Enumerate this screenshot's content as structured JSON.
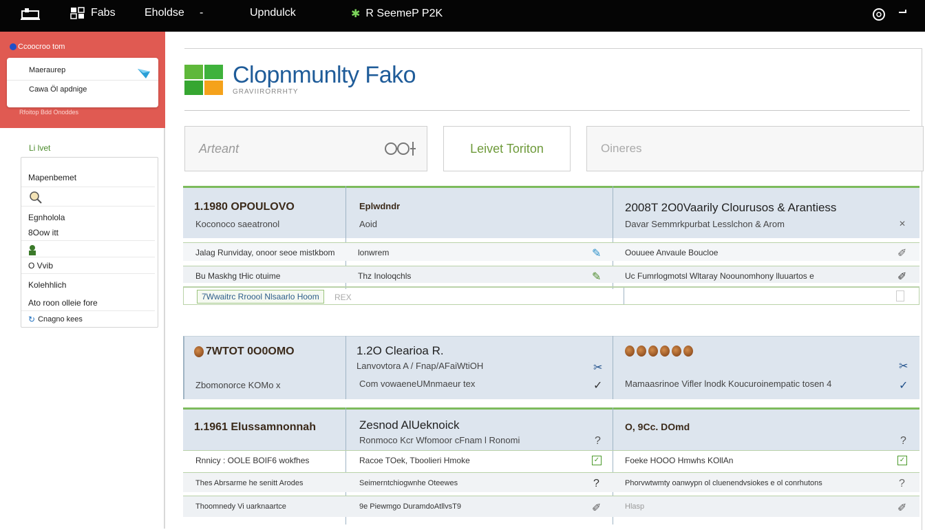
{
  "topbar": {
    "items": [
      "Fabs",
      "Eholdse",
      "-",
      "Upndulck",
      "R SeemeP P2K"
    ]
  },
  "sidebar": {
    "crumb": "Ccoocroo tom",
    "card": {
      "row1": "Maeraurep",
      "row2": "Cawa Öl apdnige"
    },
    "foot": "Rfoitop Bdd   Onoddes",
    "section_label": "Li lvet",
    "items": [
      "Mapenbemet",
      "",
      "Egnholola",
      "8Oow itt",
      "",
      "O Vvib",
      "Kolehhlich",
      "Ato roon olleie fore",
      "Cnagno kees"
    ]
  },
  "main": {
    "title": "Clopnmunlty Fako",
    "subtitle": "GRAVIIRORRHTY",
    "filters": {
      "search_placeholder": "Arteant",
      "level_button": "Leivet Toriton",
      "other_placeholder": "Oineres"
    },
    "table1": {
      "header": [
        {
          "title": "1.1980 OPOULOVO",
          "sub": "Koconoco saeatronol"
        },
        {
          "title": "Eplwdndr",
          "sub": "Aoid"
        },
        {
          "title": "2008T 2O0Vaarily  Clourusos & Arantiess",
          "sub": "Davar Semmrkpurbat Lesslchon & Arom"
        }
      ],
      "rows": [
        [
          "Jalag Runviday, onoor seoe mistkbom",
          "lonwrem",
          "Oouuee Anvaule Boucloe"
        ],
        [
          "Bu Maskhg tHic otuime",
          "Thz Inoloqchls",
          "Uc Fumrlogmotsl Wltaray Noounomhony lluuartos e"
        ]
      ],
      "input_value": "7Wwaitrc Rroool Nlsaarlo Hoom",
      "input_tag": "REX"
    },
    "table2": {
      "cols": [
        {
          "title": "7WTOT 0O0OMO",
          "sub": "Zbomonorce KOMo x"
        },
        {
          "title": "1.2O Clearioa R.",
          "line2": "Lanvovtora A / Fnap/AFaiWtiOH",
          "sub": "Com vowaeneUMnmaeur tex"
        },
        {
          "title": "",
          "sub": "Mamaasrinoe Vifler lnodk Koucuroinempatic tosen  4"
        }
      ]
    },
    "table3": {
      "header": [
        {
          "title": "1.1961 Elussamnonnah",
          "sub": ""
        },
        {
          "title": "Zesnod AlUeknoick",
          "sub": "Ronmoco Kcr Wfomoor cFnam l Ronomi"
        },
        {
          "title": "O, 9Cc. DOmd",
          "sub": ""
        }
      ],
      "rows": [
        [
          "Rnnicy : OOLE BOIF6 wokfhes",
          "Racoe TOek, Tboolieri Hmoke",
          "Foeke HOOO Hmwhs KOllAn"
        ],
        [
          "Thes Abrsarme he senitt Arodes",
          "Seimerntchiogwnhe Oteewes",
          "Phorvwtwmty oanwypn ol cluenendvsiokes e ol conrhutons"
        ],
        [
          "Thoomnedy Vi uarknaartce",
          "9e Piewmgo DuramdoAtllvsT9",
          "Hlasp"
        ]
      ]
    }
  }
}
